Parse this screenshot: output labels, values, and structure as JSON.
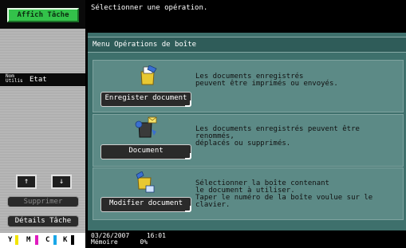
{
  "left": {
    "affich_tache": "Affich Tâche",
    "tabs_a": "Nom",
    "tabs_a2": "Utilis",
    "tabs_b": "Etat",
    "arrow_up": "↑",
    "arrow_down": "↓",
    "supprimer": "Supprimer",
    "details_tache": "Détails Tâche",
    "inks": [
      {
        "letter": "Y",
        "color": "#f2e400"
      },
      {
        "letter": "M",
        "color": "#e01bbf"
      },
      {
        "letter": "C",
        "color": "#1aa7e8"
      },
      {
        "letter": "K",
        "color": "#000000"
      }
    ]
  },
  "message": "Sélectionner une opération.",
  "menu_title": "Menu Opérations de boîte",
  "cards": [
    {
      "button": "Enregister document",
      "text": [
        "Les documents enregistrés",
        "peuvent être imprimés ou envoyés."
      ]
    },
    {
      "button": "Document",
      "text": [
        "Les documents enregistrés peuvent être renommés,",
        "déplacés ou supprimés."
      ]
    },
    {
      "button": "Modifier document",
      "text": [
        "Sélectionner la boîte contenant",
        "le document à utiliser.",
        "Taper le numéro de la boîte voulue sur le clavier."
      ]
    }
  ],
  "status": {
    "date": "03/26/2007",
    "time": "16:01",
    "memory_label": "Mémoire",
    "memory_value": "0%"
  }
}
